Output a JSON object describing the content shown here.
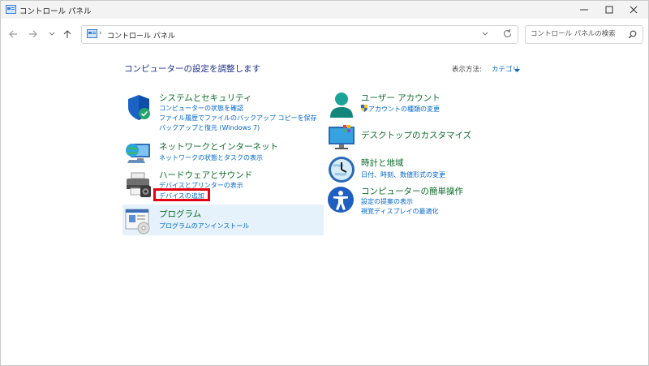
{
  "window": {
    "title": "コントロール パネル"
  },
  "address": {
    "path": "コントロール パネル",
    "search_placeholder": "コントロール パネルの検索"
  },
  "main": {
    "heading": "コンピューターの設定を調整します",
    "view_by_label": "表示方法:",
    "view_by_value": "カテゴリ"
  },
  "categories_left": [
    {
      "title": "システムとセキュリティ",
      "links": [
        "コンピューターの状態を確認",
        "ファイル履歴でファイルのバックアップ コピーを保存",
        "バックアップと復元 (Windows 7)"
      ]
    },
    {
      "title": "ネットワークとインターネット",
      "links": [
        "ネットワークの状態とタスクの表示"
      ]
    },
    {
      "title": "ハードウェアとサウンド",
      "links": [
        "デバイスとプリンターの表示",
        "デバイスの追加"
      ]
    },
    {
      "title": "プログラム",
      "links": [
        "プログラムのアンインストール"
      ]
    }
  ],
  "categories_right": [
    {
      "title": "ユーザー アカウント",
      "links": [
        "アカウントの種類の変更"
      ]
    },
    {
      "title": "デスクトップのカスタマイズ",
      "links": []
    },
    {
      "title": "時計と地域",
      "links": [
        "日付、時刻、数値形式の変更"
      ]
    },
    {
      "title": "コンピューターの簡単操作",
      "links": [
        "設定の提案の表示",
        "視覚ディスプレイの最適化"
      ]
    }
  ],
  "colors": {
    "category_title": "#0a6b28",
    "link": "#0066cc",
    "heading": "#1e3287",
    "highlight_bg": "#e5f1fb",
    "annotation_red": "#e4000f"
  }
}
